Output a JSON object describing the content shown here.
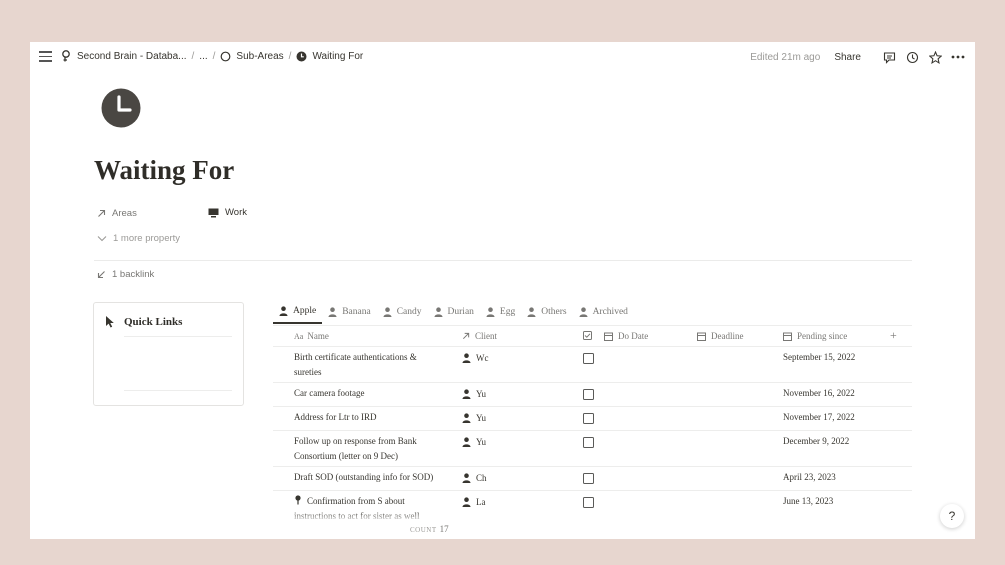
{
  "breadcrumb": {
    "items": [
      "Second Brain - Databa...",
      "...",
      "Sub-Areas",
      "Waiting For"
    ],
    "separator": "/"
  },
  "topbar": {
    "edited": "Edited 21m ago",
    "share_label": "Share",
    "icons": [
      "comment-icon",
      "history-icon",
      "star-icon",
      "more-icon"
    ]
  },
  "page": {
    "title": "Waiting For",
    "icon": "clock-icon",
    "properties": {
      "areas_label": "Areas",
      "work_label": "Work",
      "more_label": "1 more property",
      "backlink_label": "1 backlink"
    }
  },
  "quick_links": {
    "title": "Quick Links"
  },
  "tabs": [
    "Apple",
    "Banana",
    "Candy",
    "Durian",
    "Egg",
    "Others",
    "Archived"
  ],
  "table": {
    "columns": {
      "name": "Name",
      "name_prefix": "Aa",
      "client": "Client",
      "do_date": "Do Date",
      "deadline": "Deadline",
      "pending": "Pending since"
    },
    "rows": [
      {
        "name": "Birth certificate authentications & sureties",
        "client": "Wc",
        "pending": "September 15, 2022"
      },
      {
        "name": "Car camera footage",
        "client": "Yu",
        "pending": "November 16, 2022"
      },
      {
        "name": "Address for Ltr to IRD",
        "client": "Yu",
        "pending": "November 17, 2022"
      },
      {
        "name": "Follow up on response from Bank Consortium (letter on 9 Dec)",
        "client": "Yu",
        "pending": "December 9, 2022"
      },
      {
        "name": "Draft SOD (outstanding info for SOD)",
        "client": "Ch",
        "pending": "April 23, 2023"
      },
      {
        "name": "Confirmation from S     about instructions to act for sister as well",
        "client": "La",
        "pending": "June 13, 2023"
      }
    ],
    "count_label": "COUNT",
    "count_value": "17"
  },
  "help_label": "?",
  "colors": {
    "background": "#e7d6cf",
    "text": "#37352f",
    "muted": "#9b9a97"
  }
}
